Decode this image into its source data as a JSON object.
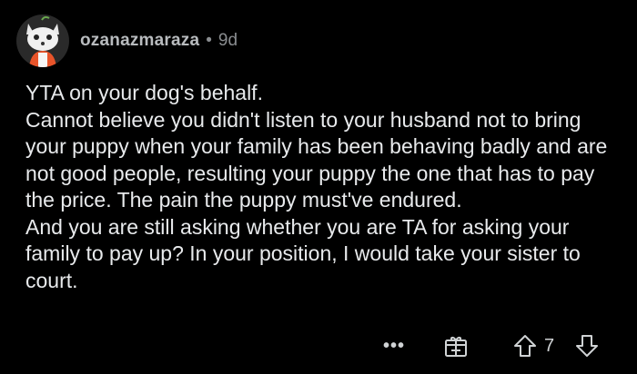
{
  "comment": {
    "username": "ozanazmaraza",
    "separator": "•",
    "age": "9d",
    "avatar_icon": "fox-avatar-icon",
    "paragraphs": [
      "YTA on your dog's behalf.",
      "Cannot believe you didn't listen to your husband not to bring your puppy when your family has been behaving badly and are not good people, resulting your puppy the one that has to pay the price. The pain the puppy must've endured.",
      "And you are still asking whether you are TA for asking your family to pay up? In your position, I would take your sister to court."
    ]
  },
  "actions": {
    "more_label": "•••",
    "award_icon": "award-gift-icon",
    "upvote_icon": "upvote-arrow-icon",
    "score": "7",
    "downvote_icon": "downvote-arrow-icon"
  },
  "colors": {
    "background": "#000000",
    "text": "#e8eaec",
    "meta": "#8a8d90",
    "avatar_bg": "#2a2a2a",
    "avatar_accent": "#e8542a"
  }
}
